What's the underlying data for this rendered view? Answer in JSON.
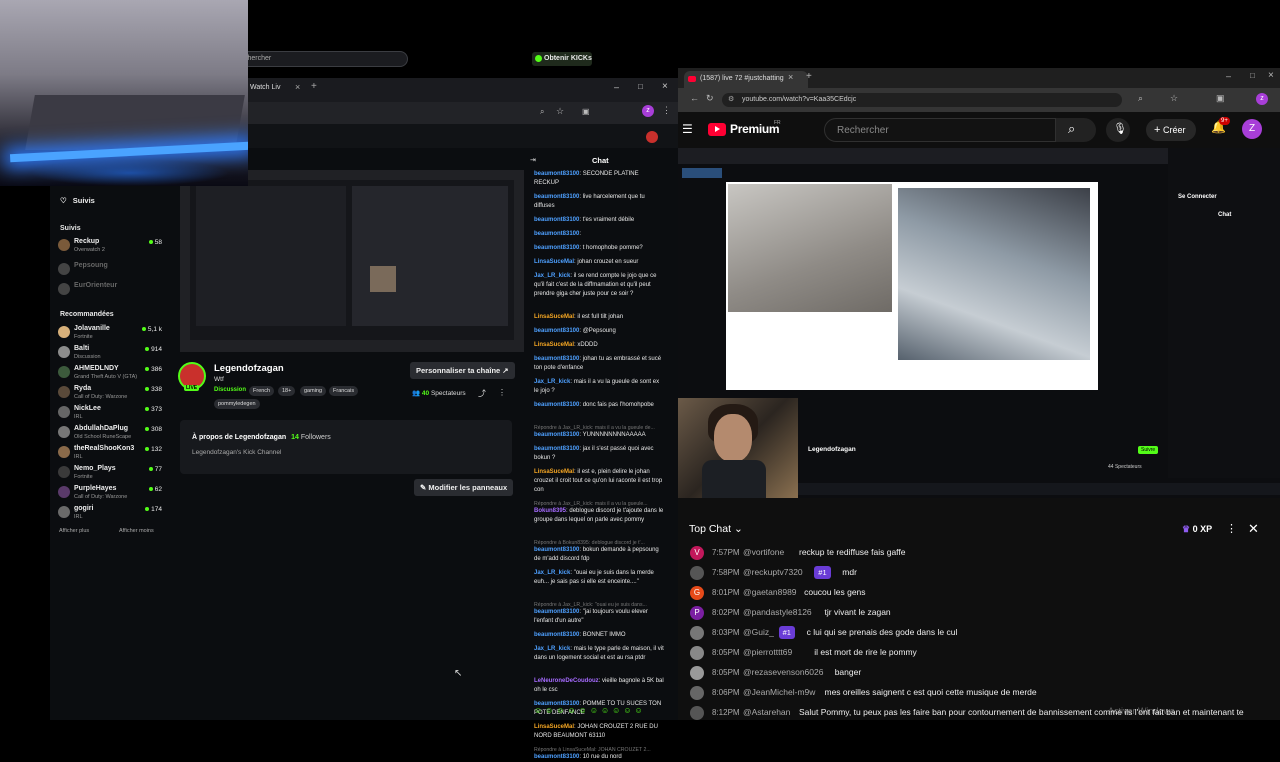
{
  "kick": {
    "tab_title": "Watch Liv",
    "search_placeholder": "Rechercher",
    "get_kicks": "Obtenir KICKs",
    "sidebar": {
      "following_nav": "Suivis",
      "section_followed": "Suivis",
      "followed": [
        {
          "name": "Reckup",
          "category": "Overwatch 2",
          "count": "58",
          "online": true
        },
        {
          "name": "Pepsoung",
          "category": "",
          "count": "",
          "online": false
        },
        {
          "name": "EurOrienteur",
          "category": "",
          "count": "",
          "online": false
        }
      ],
      "section_recommended": "Recommandées",
      "recommended": [
        {
          "name": "Jolavanille",
          "category": "Fortnite",
          "count": "5,1 k"
        },
        {
          "name": "Balti",
          "category": "Discussion",
          "count": "914"
        },
        {
          "name": "AHMEDLNDY",
          "category": "Grand Theft Auto V (GTA)",
          "count": "386"
        },
        {
          "name": "Ryda",
          "category": "Call of Duty: Warzone",
          "count": "338"
        },
        {
          "name": "NickLee",
          "category": "IRL",
          "count": "373"
        },
        {
          "name": "AbdullahDaPlug",
          "category": "Old School RuneScape",
          "count": "308"
        },
        {
          "name": "theRealShooKon3",
          "category": "IRL",
          "count": "132"
        },
        {
          "name": "Nemo_Plays",
          "category": "Fortnite",
          "count": "77"
        },
        {
          "name": "PurpleHayes",
          "category": "Call of Duty: Warzone",
          "count": "62"
        },
        {
          "name": "gogiri",
          "category": "IRL",
          "count": "174"
        }
      ],
      "show_more": "Afficher plus",
      "show_less": "Afficher moins"
    },
    "channel": {
      "name": "Legendofzagan",
      "subtitle": "Wtf",
      "live": "LIVE",
      "category": "Discussion",
      "tags": [
        "French",
        "18+",
        "gaming",
        "Francais",
        "pommyledegen"
      ],
      "customize": "Personnaliser ta chaîne",
      "viewers": "40",
      "viewers_label": "Spectateurs",
      "about_title_prefix": "À propos de Legendofzagan",
      "followers": "14",
      "followers_label": "Followers",
      "about_text": "Legendofzagan's Kick Channel",
      "edit_panels": "Modifier les panneaux"
    },
    "chat": {
      "title": "Chat",
      "messages": [
        {
          "kind": "msg",
          "user": "beaumont83100",
          "text": "SECONDE PLATINE RECKUP",
          "color": "#4ea0ff"
        },
        {
          "kind": "msg",
          "user": "beaumont83100",
          "text": "live harcelement que tu diffuses",
          "color": "#4ea0ff"
        },
        {
          "kind": "msg",
          "user": "beaumont83100",
          "text": "t'es vraiment débile",
          "color": "#4ea0ff"
        },
        {
          "kind": "msg",
          "user": "beaumont83100",
          "text": "",
          "color": "#4ea0ff"
        },
        {
          "kind": "msg",
          "user": "beaumont83100",
          "text": "t homophobe pomme?",
          "color": "#4ea0ff"
        },
        {
          "kind": "msg",
          "user": "LinsaSuceMal",
          "text": "johan crouzet en sueur",
          "color": "#4ea0ff"
        },
        {
          "kind": "msg",
          "user": "Jax_LR_kick",
          "text": "il se rend compte le jojo que ce qu'il fait c'est de la diffmamation et qu'il peut prendre giga cher juste pour ce soir ?",
          "color": "#4ea0ff"
        },
        {
          "kind": "msg",
          "user": "LinsaSuceMal",
          "text": "il est full tilt johan",
          "color": "#f5a623"
        },
        {
          "kind": "msg",
          "user": "beaumont83100",
          "text": "@Pepsoung",
          "color": "#4ea0ff"
        },
        {
          "kind": "msg",
          "user": "LinsaSuceMal",
          "text": "xDDDD",
          "color": "#f5a623"
        },
        {
          "kind": "msg",
          "user": "beaumont83100",
          "text": "johan tu as embrassé et sucé ton pote d'enfance",
          "color": "#4ea0ff"
        },
        {
          "kind": "msg",
          "user": "Jax_LR_kick",
          "text": "mais il a vu la gueule de sont ex le jojo ?",
          "color": "#4ea0ff"
        },
        {
          "kind": "msg",
          "user": "beaumont83100",
          "text": "donc fais pas l'homohpobe",
          "color": "#4ea0ff"
        },
        {
          "kind": "reply",
          "text": "Répondre à Jax_LR_kick: mais il a vu la gueule de..."
        },
        {
          "kind": "msg",
          "user": "beaumont83100",
          "text": "YUNNNNNNNNAAAAA",
          "color": "#4ea0ff"
        },
        {
          "kind": "msg",
          "user": "beaumont83100",
          "text": "jax il s'est passé quoi avec bokun ?",
          "color": "#4ea0ff"
        },
        {
          "kind": "msg",
          "user": "LinsaSuceMal",
          "text": "il est e, plein delire le johan crouzet il croit tout ce qu'on lui raconte il est trop con",
          "color": "#f5a623"
        },
        {
          "kind": "reply",
          "text": "Répondre à Jax_LR_kick: mais il a vu la gueule..."
        },
        {
          "kind": "msg",
          "user": "Bokun8395",
          "text": "deblogue discord je t'ajoute dans le groupe dans lequel on parle avec pommy",
          "color": "#a66bff"
        },
        {
          "kind": "reply",
          "text": "Répondre à Bokun8395: deblogue discord je t'..."
        },
        {
          "kind": "msg",
          "user": "beaumont83100",
          "text": "bokun demande à pepsoung de m'add discord fdp",
          "color": "#4ea0ff"
        },
        {
          "kind": "msg",
          "user": "Jax_LR_kick",
          "text": "\"ouai eu je suis dans la merde euh... je sais pas si elle est enceinte....\"",
          "color": "#4ea0ff"
        },
        {
          "kind": "reply",
          "text": "Répondre à Jax_LR_kick: \"ouai eu je suis dans..."
        },
        {
          "kind": "msg",
          "user": "beaumont83100",
          "text": "\"jai toujours voulu elever l'enfant d'un autre\"",
          "color": "#4ea0ff"
        },
        {
          "kind": "msg",
          "user": "beaumont83100",
          "text": "BONNET IMMO",
          "color": "#4ea0ff"
        },
        {
          "kind": "msg",
          "user": "Jax_LR_kick",
          "text": "mais le type parle de maison, il vit dans un logement social et est au rsa ptdr",
          "color": "#4ea0ff"
        },
        {
          "kind": "msg",
          "user": "LeNeuroneDeCoudouz",
          "text": "vieille bagnole à 5K bal oh le csc",
          "color": "#a66bff"
        },
        {
          "kind": "msg",
          "user": "beaumont83100",
          "text": "POMME TO TU SUCES TON POTE DENFANCE",
          "color": "#4ea0ff"
        },
        {
          "kind": "msg",
          "user": "LinsaSuceMal",
          "text": "JOHAN CROUZET 2 RUE DU NORD BEAUMONT 63110",
          "color": "#f5a623"
        },
        {
          "kind": "reply",
          "text": "Répondre à LinsaSuceMal: JOHAN CROUZET 2..."
        },
        {
          "kind": "msg",
          "user": "beaumont83100",
          "text": "10 rue du nord",
          "color": "#4ea0ff"
        }
      ]
    }
  },
  "youtube": {
    "tab_title": "(1587) live 72 #justchatting",
    "url": "youtube.com/watch?v=Kaa35CEdcjc",
    "brand": "Premium",
    "country": "FR",
    "search_placeholder": "Rechercher",
    "create_label": "Créer",
    "notifications": "9+",
    "avatar_letter": "Z",
    "chat": {
      "title": "Top Chat",
      "xp": "0 XP",
      "messages": [
        {
          "time": "7:57PM",
          "user": "@vortifone",
          "badge": "",
          "text": "reckup te rediffuse fais gaffe",
          "avatar": "V",
          "color": "#c2185b"
        },
        {
          "time": "7:58PM",
          "user": "@reckuptv7320",
          "badge": "#1",
          "text": "mdr",
          "avatar": "",
          "color": "#555"
        },
        {
          "time": "8:01PM",
          "user": "@gaetan8989",
          "badge": "",
          "text": "coucou les gens",
          "avatar": "G",
          "color": "#e64a19"
        },
        {
          "time": "8:02PM",
          "user": "@pandastyle8126",
          "badge": "",
          "text": "tjr vivant le zagan",
          "avatar": "P",
          "color": "#7b1fa2"
        },
        {
          "time": "8:03PM",
          "user": "@Guiz_",
          "badge": "#1",
          "text": "c lui qui se prenais des gode dans le cul",
          "avatar": "",
          "color": "#777"
        },
        {
          "time": "8:05PM",
          "user": "@pierrotttt69",
          "badge": "",
          "text": "il est mort de rire le pommy",
          "avatar": "",
          "color": "#888"
        },
        {
          "time": "8:05PM",
          "user": "@rezasevenson6026",
          "badge": "",
          "text": "banger",
          "avatar": "",
          "color": "#999"
        },
        {
          "time": "8:06PM",
          "user": "@JeanMichel-m9w",
          "badge": "",
          "text": "mes oreilles saignent c est quoi cette musique de merde",
          "avatar": "",
          "color": "#666"
        },
        {
          "time": "8:12PM",
          "user": "@Astarehan",
          "badge": "",
          "text": "Salut Pommy, tu peux pas les faire ban pour contournement de bannissement comme ils l'ont fait ban et maintenant te",
          "avatar": "",
          "color": "#555"
        }
      ]
    },
    "stream_overlay": {
      "channel": "Legendofzagan",
      "spectators": "44 Spectateurs",
      "follow": "Suivre",
      "connect": "Se Connecter",
      "chat_title": "Chat",
      "windows_watermark": "Activer Windows"
    }
  }
}
